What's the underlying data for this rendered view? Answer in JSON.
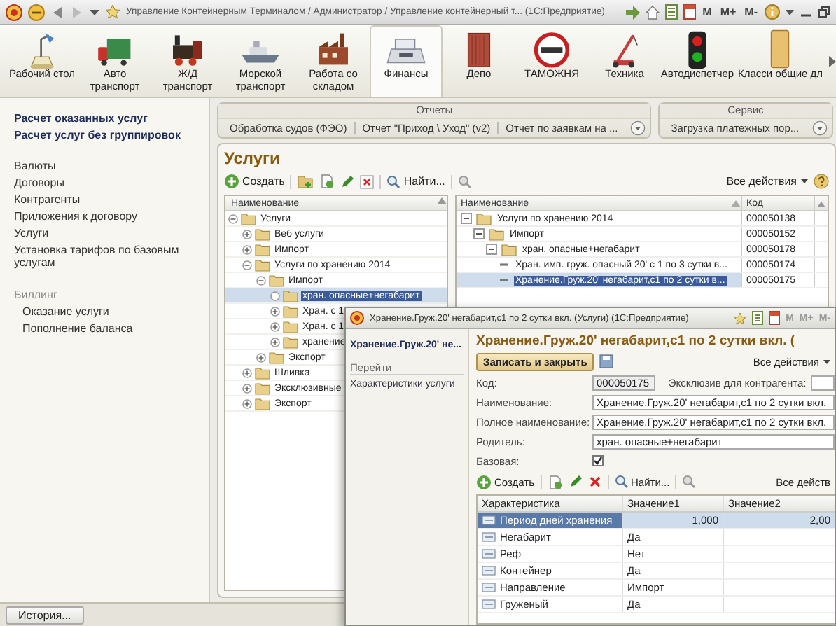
{
  "window": {
    "title": "Управление Контейнерным Терминалом / Администратор / Управление контейнерный т... (1С:Предприятие)",
    "memory_buttons": [
      "M",
      "M+",
      "M-"
    ]
  },
  "sections": [
    {
      "label": "Рабочий стол",
      "selected": false
    },
    {
      "label": "Авто транспорт",
      "selected": false
    },
    {
      "label": "Ж/Д транспорт",
      "selected": false
    },
    {
      "label": "Морской транспорт",
      "selected": false
    },
    {
      "label": "Работа со складом",
      "selected": false
    },
    {
      "label": "Финансы",
      "selected": true
    },
    {
      "label": "Депо",
      "selected": false
    },
    {
      "label": "ТАМОЖНЯ",
      "selected": false
    },
    {
      "label": "Техника",
      "selected": false
    },
    {
      "label": "Автодиспетчер",
      "selected": false
    },
    {
      "label": "Класси общие дл",
      "selected": false
    }
  ],
  "navigation": {
    "bold_links": [
      "Расчет оказанных услуг",
      "Расчет услуг без группировок"
    ],
    "links": [
      "Валюты",
      "Договоры",
      "Контрагенты",
      "Приложения к договору",
      "Услуги",
      "Установка тарифов по базовым услугам"
    ],
    "groups": [
      {
        "title": "Биллинг",
        "items": [
          "Оказание услуги",
          "Пополнение баланса"
        ]
      }
    ]
  },
  "command_panels": [
    {
      "title": "Отчеты",
      "items": [
        "Обработка судов (ФЭО)",
        "Отчет \"Приход \\ Уход\" (v2)",
        "Отчет по заявкам на ..."
      ]
    },
    {
      "title": "Сервис",
      "items": [
        "Загрузка платежных пор..."
      ]
    }
  ],
  "services": {
    "title": "Услуги",
    "create_button": "Создать",
    "find_button": "Найти...",
    "all_actions": "Все действия",
    "tree": {
      "column": "Наименование",
      "nodes": [
        {
          "label": "Услуги",
          "expanded": true,
          "selected": false,
          "children": [
            {
              "label": "Веб услуги",
              "expanded": false,
              "selected": false
            },
            {
              "label": "Импорт",
              "expanded": false,
              "selected": false
            },
            {
              "label": "Услуги по хранению 2014",
              "expanded": true,
              "selected": false,
              "children": [
                {
                  "label": "Импорт",
                  "expanded": true,
                  "selected": false,
                  "children": [
                    {
                      "label": "хран. опасные+негабарит",
                      "selected": true
                    },
                    {
                      "label": "Хран. с 1",
                      "expanded": false,
                      "selected": false
                    },
                    {
                      "label": "Хран. с 1",
                      "expanded": false,
                      "selected": false
                    },
                    {
                      "label": "хранение",
                      "expanded": false,
                      "selected": false
                    }
                  ]
                },
                {
                  "label": "Экспорт",
                  "expanded": false,
                  "selected": false
                }
              ]
            },
            {
              "label": "Шливка",
              "expanded": false,
              "selected": false
            },
            {
              "label": "Эксклюзивные",
              "expanded": false,
              "selected": false
            },
            {
              "label": "Экспорт",
              "expanded": false,
              "selected": false
            }
          ]
        }
      ]
    },
    "table": {
      "columns": [
        "Наименование",
        "Код"
      ],
      "rows": [
        {
          "name": "Услуги по хранению 2014",
          "code": "000050138",
          "selected": false,
          "children": [
            {
              "name": "Импорт",
              "code": "000050152",
              "selected": false,
              "children": [
                {
                  "name": "хран. опасные+негабарит",
                  "code": "000050178",
                  "selected": false,
                  "children": [
                    {
                      "name": "Хран. имп. груж. опасный 20' с 1 по 3 сутки в...",
                      "code": "000050174",
                      "selected": false
                    },
                    {
                      "name": "Хранение.Груж.20' негабарит,с1 по 2 сутки в...",
                      "code": "000050175",
                      "selected": true
                    }
                  ]
                }
              ]
            }
          ]
        }
      ]
    }
  },
  "dialog": {
    "title": "Хранение.Груж.20' негабарит,с1 по 2 сутки вкл. (Услуги) (1С:Предприятие)",
    "memory_buttons": [
      "M",
      "M+",
      "M-"
    ],
    "nav_title": "Хранение.Груж.20' не...",
    "nav_group": "Перейти",
    "nav_items": [
      "Характеристики услуги"
    ],
    "heading": "Хранение.Груж.20' негабарит,с1 по 2 сутки вкл. (",
    "save_close_button": "Записать и закрыть",
    "all_actions": "Все действия",
    "code_label": "Код:",
    "code": "000050175",
    "exclusive_label": "Эксклюзив для контрагента:",
    "fields": [
      {
        "label": "Наименование:",
        "value": "Хранение.Груж.20' негабарит,с1 по 2 сутки вкл."
      },
      {
        "label": "Полное наименование:",
        "value": "Хранение.Груж.20' негабарит,с1 по 2 сутки вкл."
      },
      {
        "label": "Родитель:",
        "value": "хран. опасные+негабарит"
      }
    ],
    "base_label": "Базовая:",
    "base_checked": true,
    "create_button": "Создать",
    "find_button": "Найти...",
    "all_actions_short": "Все действ",
    "columns": [
      "Характеристика",
      "Значение1",
      "Значение2"
    ],
    "rows": [
      {
        "cells": [
          "Период дней хранения",
          "1,000",
          "2,00"
        ],
        "selected": true
      },
      {
        "cells": [
          "Негабарит",
          "Да",
          ""
        ],
        "selected": false
      },
      {
        "cells": [
          "Реф",
          "Нет",
          ""
        ],
        "selected": false
      },
      {
        "cells": [
          "Контейнер",
          "Да",
          ""
        ],
        "selected": false
      },
      {
        "cells": [
          "Направление",
          "Импорт",
          ""
        ],
        "selected": false
      },
      {
        "cells": [
          "Груженый",
          "Да",
          ""
        ],
        "selected": false
      }
    ]
  },
  "status_bar": {
    "history_button": "История..."
  }
}
